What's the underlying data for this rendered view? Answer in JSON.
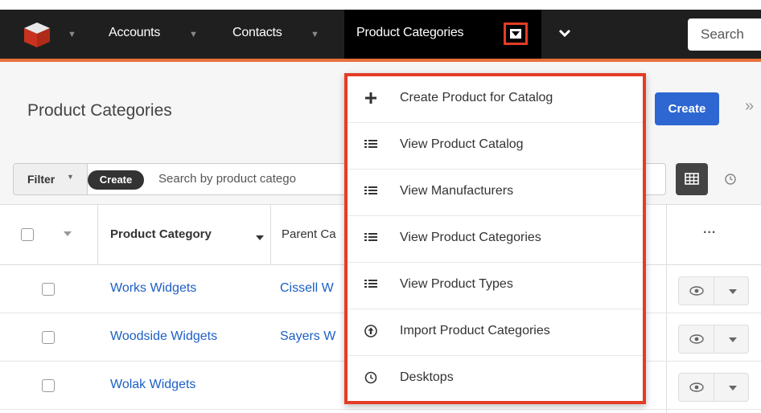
{
  "nav": {
    "accounts": "Accounts",
    "contacts": "Contacts",
    "product_categories": "Product Categories",
    "search_placeholder": "Search"
  },
  "header": {
    "title": "Product Categories",
    "create": "Create"
  },
  "filter": {
    "label": "Filter",
    "create_chip": "Create",
    "search_placeholder": "Search by product catego"
  },
  "table": {
    "col_category": "Product Category",
    "col_parent": "Parent Ca",
    "actions": "...",
    "rows": [
      {
        "category": "Works Widgets",
        "parent": "Cissell W"
      },
      {
        "category": "Woodside Widgets",
        "parent": "Sayers W"
      },
      {
        "category": "Wolak Widgets",
        "parent": ""
      }
    ]
  },
  "menu": {
    "items": [
      {
        "icon": "plus-icon",
        "label": "Create Product for Catalog"
      },
      {
        "icon": "list-icon",
        "label": "View Product Catalog"
      },
      {
        "icon": "list-icon",
        "label": "View Manufacturers"
      },
      {
        "icon": "list-icon",
        "label": "View Product Categories"
      },
      {
        "icon": "list-icon",
        "label": "View Product Types"
      },
      {
        "icon": "upload-icon",
        "label": "Import Product Categories"
      },
      {
        "icon": "clock-icon",
        "label": "Desktops"
      }
    ]
  },
  "colors": {
    "accent_blue": "#2e67d1",
    "highlight_red": "#e53c25",
    "nav_bg": "#1f1f1f",
    "link_blue": "#1c5fc6"
  }
}
